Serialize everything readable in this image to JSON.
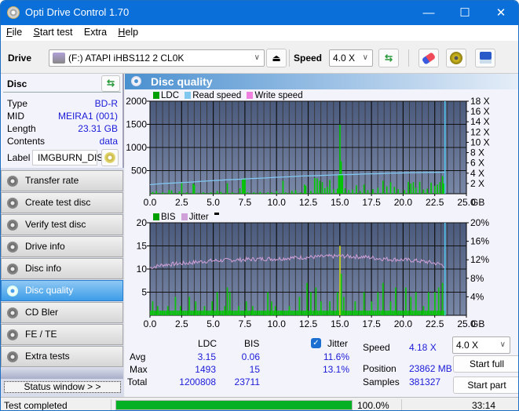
{
  "window": {
    "title": "Opti Drive Control 1.70",
    "controls": {
      "minimize": "—",
      "maximize": "☐",
      "close": "✕"
    }
  },
  "menu": [
    {
      "label": "File",
      "accel": "F",
      "rest": "ile"
    },
    {
      "label": "Start test",
      "accel": "S",
      "rest": "tart test"
    },
    {
      "label": "Extra",
      "accel": "",
      "rest": "Extra"
    },
    {
      "label": "Help",
      "accel": "H",
      "rest": "elp"
    }
  ],
  "toolbar": {
    "drive_label": "Drive",
    "drive_value": "(F:)  ATAPI iHBS112  2 CL0K",
    "speed_label": "Speed",
    "speed_value": "4.0 X",
    "icons": [
      "eject-icon",
      "refresh-icon",
      "erase-icon",
      "settings-icon",
      "save-icon"
    ]
  },
  "disc": {
    "header": "Disc",
    "rows": [
      {
        "label": "Type",
        "value": "BD-R"
      },
      {
        "label": "MID",
        "value": "MEIRA1 (001)"
      },
      {
        "label": "Length",
        "value": "23.31 GB"
      },
      {
        "label": "Contents",
        "value": "data"
      }
    ],
    "label_label": "Label",
    "label_value": "IMGBURN_DIS"
  },
  "nav": [
    {
      "label": "Transfer rate",
      "active": false
    },
    {
      "label": "Create test disc",
      "active": false
    },
    {
      "label": "Verify test disc",
      "active": false
    },
    {
      "label": "Drive info",
      "active": false
    },
    {
      "label": "Disc info",
      "active": false
    },
    {
      "label": "Disc quality",
      "active": true
    },
    {
      "label": "CD Bler",
      "active": false
    },
    {
      "label": "FE / TE",
      "active": false
    },
    {
      "label": "Extra tests",
      "active": false
    }
  ],
  "status_window_label": "Status window > >",
  "panel": {
    "title": "Disc quality"
  },
  "colors": {
    "ldc": "#00a000",
    "read_speed": "#80c8f0",
    "write_speed": "#f080e0",
    "bis": "#00a000",
    "jitter": "#d0a0d8",
    "plot_bg_top": "#4a5a7c",
    "plot_bg_bottom": "#7a88a8",
    "progress": "#06b025"
  },
  "chart_data": [
    {
      "type": "bar",
      "title": "LDC / Read speed",
      "legend": [
        "LDC",
        "Read speed",
        "Write speed"
      ],
      "xlabel": "GB",
      "xlim": [
        0,
        25
      ],
      "x_ticks": [
        "0.0",
        "2.5",
        "5.0",
        "7.5",
        "10.0",
        "12.5",
        "15.0",
        "17.5",
        "20.0",
        "22.5",
        "25.0"
      ],
      "ylim": [
        0,
        2000
      ],
      "y_ticks": [
        "500",
        "1000",
        "1500",
        "2000"
      ],
      "y2lim": [
        0,
        18
      ],
      "y2_ticks": [
        "2 X",
        "4 X",
        "6 X",
        "8 X",
        "10 X",
        "12 X",
        "14 X",
        "16 X",
        "18 X"
      ],
      "end_marker_gb": 23.31,
      "ldc_spikes": [
        {
          "x": 0.2,
          "y": 40
        },
        {
          "x": 0.5,
          "y": 60
        },
        {
          "x": 1.0,
          "y": 30
        },
        {
          "x": 1.5,
          "y": 80
        },
        {
          "x": 1.7,
          "y": 70
        },
        {
          "x": 2.3,
          "y": 50
        },
        {
          "x": 2.5,
          "y": 250
        },
        {
          "x": 2.9,
          "y": 30
        },
        {
          "x": 3.4,
          "y": 220
        },
        {
          "x": 3.5,
          "y": 190
        },
        {
          "x": 4.2,
          "y": 30
        },
        {
          "x": 4.8,
          "y": 30
        },
        {
          "x": 5.3,
          "y": 60
        },
        {
          "x": 5.6,
          "y": 40
        },
        {
          "x": 6.1,
          "y": 230
        },
        {
          "x": 6.5,
          "y": 30
        },
        {
          "x": 7.1,
          "y": 120
        },
        {
          "x": 7.3,
          "y": 310
        },
        {
          "x": 7.4,
          "y": 320
        },
        {
          "x": 7.5,
          "y": 340
        },
        {
          "x": 7.7,
          "y": 30
        },
        {
          "x": 8.2,
          "y": 30
        },
        {
          "x": 8.7,
          "y": 40
        },
        {
          "x": 9.3,
          "y": 30
        },
        {
          "x": 9.6,
          "y": 30
        },
        {
          "x": 10.0,
          "y": 60
        },
        {
          "x": 10.5,
          "y": 280
        },
        {
          "x": 10.7,
          "y": 30
        },
        {
          "x": 11.2,
          "y": 60
        },
        {
          "x": 11.5,
          "y": 80
        },
        {
          "x": 11.9,
          "y": 30
        },
        {
          "x": 12.2,
          "y": 200
        },
        {
          "x": 12.3,
          "y": 170
        },
        {
          "x": 12.7,
          "y": 60
        },
        {
          "x": 13.0,
          "y": 340
        },
        {
          "x": 13.2,
          "y": 330
        },
        {
          "x": 13.4,
          "y": 280
        },
        {
          "x": 13.6,
          "y": 250
        },
        {
          "x": 13.8,
          "y": 120
        },
        {
          "x": 14.0,
          "y": 150
        },
        {
          "x": 14.2,
          "y": 300
        },
        {
          "x": 14.5,
          "y": 100
        },
        {
          "x": 14.8,
          "y": 110
        },
        {
          "x": 14.9,
          "y": 420
        },
        {
          "x": 15.0,
          "y": 1493
        },
        {
          "x": 15.1,
          "y": 700
        },
        {
          "x": 15.2,
          "y": 400
        },
        {
          "x": 15.4,
          "y": 120
        },
        {
          "x": 15.7,
          "y": 80
        },
        {
          "x": 16.0,
          "y": 90
        },
        {
          "x": 16.3,
          "y": 180
        },
        {
          "x": 16.6,
          "y": 60
        },
        {
          "x": 16.9,
          "y": 200
        },
        {
          "x": 17.2,
          "y": 80
        },
        {
          "x": 17.6,
          "y": 100
        },
        {
          "x": 18.0,
          "y": 130
        },
        {
          "x": 18.4,
          "y": 280
        },
        {
          "x": 18.7,
          "y": 160
        },
        {
          "x": 19.0,
          "y": 250
        },
        {
          "x": 19.3,
          "y": 150
        },
        {
          "x": 19.6,
          "y": 100
        },
        {
          "x": 20.1,
          "y": 80
        },
        {
          "x": 20.4,
          "y": 260
        },
        {
          "x": 20.6,
          "y": 220
        },
        {
          "x": 20.8,
          "y": 250
        },
        {
          "x": 21.0,
          "y": 130
        },
        {
          "x": 21.3,
          "y": 260
        },
        {
          "x": 21.6,
          "y": 90
        },
        {
          "x": 21.9,
          "y": 110
        },
        {
          "x": 22.2,
          "y": 240
        },
        {
          "x": 22.5,
          "y": 170
        },
        {
          "x": 22.7,
          "y": 200
        },
        {
          "x": 22.9,
          "y": 250
        },
        {
          "x": 23.1,
          "y": 380
        },
        {
          "x": 23.2,
          "y": 220
        }
      ],
      "read_speed": [
        {
          "x": 0.0,
          "y": 1.75
        },
        {
          "x": 0.8,
          "y": 1.95
        },
        {
          "x": 1.6,
          "y": 2.05
        },
        {
          "x": 2.4,
          "y": 2.15
        },
        {
          "x": 3.2,
          "y": 2.25
        },
        {
          "x": 4.0,
          "y": 2.4
        },
        {
          "x": 5.0,
          "y": 2.55
        },
        {
          "x": 6.0,
          "y": 2.7
        },
        {
          "x": 7.0,
          "y": 2.8
        },
        {
          "x": 8.0,
          "y": 2.95
        },
        {
          "x": 9.0,
          "y": 3.05
        },
        {
          "x": 10.0,
          "y": 3.2
        },
        {
          "x": 11.0,
          "y": 3.3
        },
        {
          "x": 12.0,
          "y": 3.45
        },
        {
          "x": 13.0,
          "y": 3.5
        },
        {
          "x": 14.0,
          "y": 3.6
        },
        {
          "x": 15.0,
          "y": 3.7
        },
        {
          "x": 16.0,
          "y": 3.75
        },
        {
          "x": 17.0,
          "y": 3.85
        },
        {
          "x": 18.0,
          "y": 3.9
        },
        {
          "x": 19.0,
          "y": 4.0
        },
        {
          "x": 20.0,
          "y": 4.05
        },
        {
          "x": 21.0,
          "y": 4.1
        },
        {
          "x": 22.0,
          "y": 4.15
        },
        {
          "x": 23.31,
          "y": 4.18
        }
      ]
    },
    {
      "type": "bar",
      "title": "BIS / Jitter",
      "legend": [
        "BIS",
        "Jitter"
      ],
      "xlabel": "GB",
      "xlim": [
        0,
        25
      ],
      "x_ticks": [
        "0.0",
        "2.5",
        "5.0",
        "7.5",
        "10.0",
        "12.5",
        "15.0",
        "17.5",
        "20.0",
        "22.5",
        "25.0"
      ],
      "ylim": [
        0,
        20
      ],
      "y_ticks": [
        "5",
        "10",
        "15",
        "20"
      ],
      "y2lim": [
        0,
        20
      ],
      "y2_ticks": [
        "4%",
        "8%",
        "12%",
        "16%",
        "20%"
      ],
      "end_marker_gb": 23.31,
      "bis_spikes": [
        {
          "x": 0.2,
          "y": 3
        },
        {
          "x": 0.6,
          "y": 2
        },
        {
          "x": 1.0,
          "y": 1
        },
        {
          "x": 1.4,
          "y": 2
        },
        {
          "x": 2.0,
          "y": 4
        },
        {
          "x": 2.4,
          "y": 2
        },
        {
          "x": 3.1,
          "y": 4
        },
        {
          "x": 3.6,
          "y": 3
        },
        {
          "x": 4.3,
          "y": 2
        },
        {
          "x": 4.9,
          "y": 3
        },
        {
          "x": 5.3,
          "y": 5
        },
        {
          "x": 5.9,
          "y": 2
        },
        {
          "x": 6.1,
          "y": 6
        },
        {
          "x": 6.3,
          "y": 5
        },
        {
          "x": 7.0,
          "y": 2
        },
        {
          "x": 7.6,
          "y": 3
        },
        {
          "x": 8.1,
          "y": 2
        },
        {
          "x": 9.3,
          "y": 5
        },
        {
          "x": 9.6,
          "y": 3
        },
        {
          "x": 9.9,
          "y": 2
        },
        {
          "x": 10.4,
          "y": 1
        },
        {
          "x": 11.0,
          "y": 2
        },
        {
          "x": 11.8,
          "y": 4
        },
        {
          "x": 12.4,
          "y": 7
        },
        {
          "x": 12.7,
          "y": 5
        },
        {
          "x": 13.1,
          "y": 6
        },
        {
          "x": 13.5,
          "y": 3
        },
        {
          "x": 14.2,
          "y": 3
        },
        {
          "x": 14.8,
          "y": 5
        },
        {
          "x": 15.0,
          "y": 15
        },
        {
          "x": 15.1,
          "y": 9
        },
        {
          "x": 15.3,
          "y": 4
        },
        {
          "x": 16.2,
          "y": 3
        },
        {
          "x": 16.9,
          "y": 5
        },
        {
          "x": 17.5,
          "y": 3
        },
        {
          "x": 18.0,
          "y": 5
        },
        {
          "x": 18.4,
          "y": 7
        },
        {
          "x": 19.0,
          "y": 3
        },
        {
          "x": 19.4,
          "y": 6
        },
        {
          "x": 20.2,
          "y": 6
        },
        {
          "x": 20.6,
          "y": 4
        },
        {
          "x": 21.0,
          "y": 5
        },
        {
          "x": 21.6,
          "y": 2
        },
        {
          "x": 22.0,
          "y": 5
        },
        {
          "x": 22.5,
          "y": 5
        },
        {
          "x": 22.8,
          "y": 6
        },
        {
          "x": 23.1,
          "y": 7
        }
      ],
      "bis_baseline": 1,
      "jitter_trend": [
        {
          "x": 0.0,
          "y": 10.3
        },
        {
          "x": 1.0,
          "y": 10.9
        },
        {
          "x": 2.0,
          "y": 11.1
        },
        {
          "x": 3.0,
          "y": 11.3
        },
        {
          "x": 4.0,
          "y": 11.6
        },
        {
          "x": 5.0,
          "y": 11.8
        },
        {
          "x": 6.0,
          "y": 11.9
        },
        {
          "x": 7.0,
          "y": 12.0
        },
        {
          "x": 8.0,
          "y": 12.1
        },
        {
          "x": 9.0,
          "y": 12.2
        },
        {
          "x": 10.0,
          "y": 12.2
        },
        {
          "x": 11.0,
          "y": 12.4
        },
        {
          "x": 12.0,
          "y": 12.5
        },
        {
          "x": 13.0,
          "y": 12.6
        },
        {
          "x": 14.0,
          "y": 12.7
        },
        {
          "x": 15.0,
          "y": 12.8
        },
        {
          "x": 16.0,
          "y": 12.7
        },
        {
          "x": 17.0,
          "y": 12.6
        },
        {
          "x": 18.0,
          "y": 12.3
        },
        {
          "x": 19.0,
          "y": 12.1
        },
        {
          "x": 20.0,
          "y": 12.0
        },
        {
          "x": 21.0,
          "y": 11.8
        },
        {
          "x": 22.0,
          "y": 11.5
        },
        {
          "x": 23.0,
          "y": 11.0
        },
        {
          "x": 23.31,
          "y": 10.6
        }
      ]
    }
  ],
  "stats": {
    "col_ldc": "LDC",
    "col_bis": "BIS",
    "jitter_label": "Jitter",
    "jitter_checked": true,
    "rows": [
      {
        "label": "Avg",
        "ldc": "3.15",
        "bis": "0.06",
        "jitter": "11.6%"
      },
      {
        "label": "Max",
        "ldc": "1493",
        "bis": "15",
        "jitter": "13.1%"
      },
      {
        "label": "Total",
        "ldc": "1200808",
        "bis": "23711",
        "jitter": ""
      }
    ],
    "speed_label": "Speed",
    "speed_value": "4.18 X",
    "position_label": "Position",
    "position_value": "23862 MB",
    "samples_label": "Samples",
    "samples_value": "381327",
    "speed_select": "4.0 X",
    "start_full": "Start full",
    "start_part": "Start part"
  },
  "statusbar": {
    "text": "Test completed",
    "progress": 100.0,
    "progress_text": "100.0%",
    "time": "33:14"
  }
}
